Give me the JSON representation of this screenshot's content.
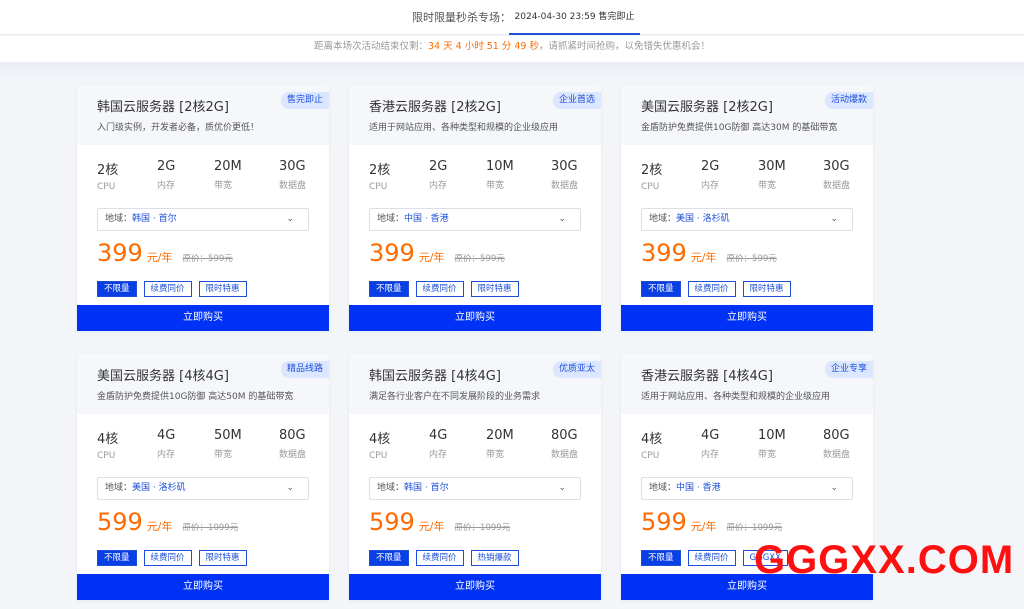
{
  "header": {
    "label": "限时限量秒杀专场：",
    "active_tab": "2024-04-30 23:59 售完即止"
  },
  "countdown": {
    "prefix": "距离本场次活动结束仅剩：",
    "time": "34 天 4 小时 51 分 49 秒",
    "suffix": "，请抓紧时间抢购，以免错失优惠机会！"
  },
  "spec_units": [
    "CPU",
    "内存",
    "带宽",
    "数据盘"
  ],
  "buy_label": "立即购买",
  "region_label": "地域：",
  "cards": [
    {
      "title": "韩国云服务器 [2核2G]",
      "badge": "售完即止",
      "desc": "入门级实例，开发者必备，质优价更低！",
      "specs": [
        "2核",
        "2G",
        "20M",
        "30G"
      ],
      "region": "韩国 · 首尔",
      "price": "399",
      "per": "元/年",
      "original": "原价：599元",
      "tags": [
        "不限量",
        "续费同价",
        "限时特惠"
      ]
    },
    {
      "title": "香港云服务器 [2核2G]",
      "badge": "企业首选",
      "desc": "适用于网站应用、各种类型和规模的企业级应用",
      "specs": [
        "2核",
        "2G",
        "10M",
        "30G"
      ],
      "region": "中国 · 香港",
      "price": "399",
      "per": "元/年",
      "original": "原价：599元",
      "tags": [
        "不限量",
        "续费同价",
        "限时特惠"
      ]
    },
    {
      "title": "美国云服务器 [2核2G]",
      "badge": "活动爆款",
      "desc": "金盾防护免费提供10G防御 高达30M 的基础带宽",
      "specs": [
        "2核",
        "2G",
        "30M",
        "30G"
      ],
      "region": "美国 · 洛杉矶",
      "price": "399",
      "per": "元/年",
      "original": "原价：599元",
      "tags": [
        "不限量",
        "续费同价",
        "限时特惠"
      ]
    },
    {
      "title": "美国云服务器 [4核4G]",
      "badge": "精品线路",
      "desc": "金盾防护免费提供10G防御 高达50M 的基础带宽",
      "specs": [
        "4核",
        "4G",
        "50M",
        "80G"
      ],
      "region": "美国 · 洛杉矶",
      "price": "599",
      "per": "元/年",
      "original": "原价：1099元",
      "tags": [
        "不限量",
        "续费同价",
        "限时特惠"
      ]
    },
    {
      "title": "韩国云服务器 [4核4G]",
      "badge": "优质亚太",
      "desc": "满足各行业客户在不同发展阶段的业务需求",
      "specs": [
        "4核",
        "4G",
        "20M",
        "80G"
      ],
      "region": "韩国 · 首尔",
      "price": "599",
      "per": "元/年",
      "original": "原价：1099元",
      "tags": [
        "不限量",
        "续费同价",
        "热销爆款"
      ]
    },
    {
      "title": "香港云服务器 [4核4G]",
      "badge": "企业专享",
      "desc": "适用于网站应用、各种类型和规模的企业级应用",
      "specs": [
        "4核",
        "4G",
        "10M",
        "80G"
      ],
      "region": "中国 · 香港",
      "price": "599",
      "per": "元/年",
      "original": "原价：1099元",
      "tags": [
        "不限量",
        "续费同价",
        "GGGXX"
      ]
    }
  ],
  "watermark": "GGGXX.COM"
}
